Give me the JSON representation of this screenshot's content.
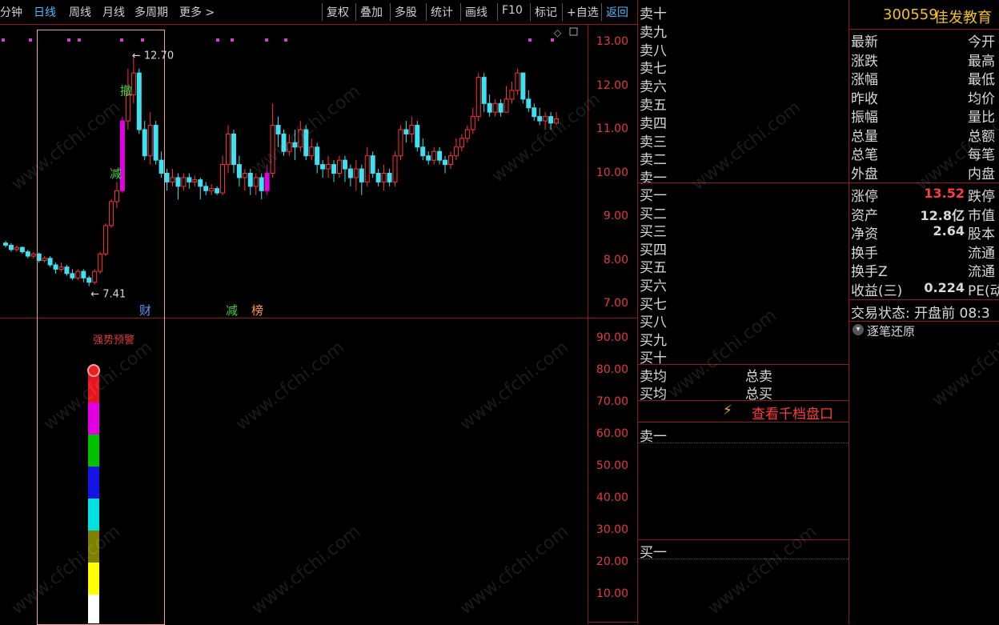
{
  "toolbar": {
    "left_items": [
      "分钟",
      "日线",
      "周线",
      "月线",
      "多周期",
      "更多 >"
    ],
    "right_items": [
      "复权",
      "叠加",
      "多股",
      "统计",
      "画线",
      "F10",
      "标记",
      "+自选",
      "返回"
    ],
    "active": "日线"
  },
  "chart": {
    "price_axis": [
      "13.00",
      "12.00",
      "11.00",
      "10.00",
      "9.00",
      "8.00",
      "7.00"
    ],
    "high_label": "12.70",
    "low_label": "7.41",
    "mark_labels": [
      "撤",
      "减"
    ],
    "event_tags": [
      "财",
      "减",
      "榜"
    ],
    "indicator_axis": [
      "90.00",
      "80.00",
      "70.00",
      "60.00",
      "50.00",
      "40.00",
      "30.00",
      "20.00",
      "10.00"
    ],
    "indicator_title": "强势预警"
  },
  "orderbook": {
    "sell_levels": [
      "卖十",
      "卖九",
      "卖八",
      "卖七",
      "卖六",
      "卖五",
      "卖四",
      "卖三",
      "卖二",
      "卖一"
    ],
    "buy_levels": [
      "买一",
      "买二",
      "买三",
      "买四",
      "买五",
      "买六",
      "买七",
      "买八",
      "买九",
      "买十"
    ],
    "sell_avg": "卖均",
    "buy_avg": "买均",
    "total_sell": "总卖",
    "total_buy": "总买",
    "thousand_link": "查看千档盘口",
    "detail_sell": "卖一",
    "detail_buy": "买一"
  },
  "quote": {
    "code": "300559",
    "name": "佳发教育",
    "left_labels": [
      "最新",
      "涨跌",
      "涨幅",
      "昨收",
      "振幅",
      "总量",
      "总笔",
      "外盘"
    ],
    "right_labels": [
      "今开",
      "最高",
      "最低",
      "均价",
      "量比",
      "总额",
      "每笔",
      "内盘"
    ],
    "stats": [
      {
        "label": "涨停",
        "value": "13.52",
        "right": "跌停"
      },
      {
        "label": "资产",
        "value": "12.8亿",
        "right": "市值"
      },
      {
        "label": "净资",
        "value": "2.64",
        "right": "股本"
      },
      {
        "label": "换手",
        "value": "",
        "right": "流通"
      },
      {
        "label": "换手Z",
        "value": "",
        "right": "流通"
      },
      {
        "label": "收益(三)",
        "value": "0.224",
        "right": "PE(动"
      }
    ],
    "trade_status": "交易状态: 开盘前 08:3",
    "tick_restore": "逐笔还原"
  },
  "watermark_text": "www.cfchi.com",
  "chart_data": {
    "type": "candlestick",
    "price_range": [
      6.8,
      13.4
    ],
    "up_color": "#ff3232",
    "down_color": "#40e0f0",
    "indicator_range": [
      5,
      97
    ],
    "indicator_blocks": [
      {
        "from": 80,
        "to": 70,
        "color": "#e6141e"
      },
      {
        "from": 70,
        "to": 60,
        "color": "#e000e0"
      },
      {
        "from": 60,
        "to": 50,
        "color": "#00c000"
      },
      {
        "from": 50,
        "to": 40,
        "color": "#1414e6"
      },
      {
        "from": 40,
        "to": 30,
        "color": "#00e0e0"
      },
      {
        "from": 30,
        "to": 20,
        "color": "#808000"
      },
      {
        "from": 20,
        "to": 10,
        "color": "#ffff00"
      },
      {
        "from": 10,
        "to": 1,
        "color": "#ffffff"
      }
    ],
    "candles": [
      {
        "o": 8.4,
        "c": 8.35,
        "h": 8.45,
        "l": 8.3
      },
      {
        "o": 8.35,
        "c": 8.25,
        "h": 8.4,
        "l": 8.2
      },
      {
        "o": 8.25,
        "c": 8.3,
        "h": 8.35,
        "l": 8.2
      },
      {
        "o": 8.3,
        "c": 8.2,
        "h": 8.32,
        "l": 8.15
      },
      {
        "o": 8.2,
        "c": 8.1,
        "h": 8.25,
        "l": 8.05
      },
      {
        "o": 8.1,
        "c": 8.15,
        "h": 8.2,
        "l": 8.05
      },
      {
        "o": 8.15,
        "c": 8.0,
        "h": 8.18,
        "l": 7.95
      },
      {
        "o": 8.0,
        "c": 8.05,
        "h": 8.1,
        "l": 7.95
      },
      {
        "o": 8.05,
        "c": 7.9,
        "h": 8.1,
        "l": 7.85
      },
      {
        "o": 7.9,
        "c": 7.8,
        "h": 7.95,
        "l": 7.7
      },
      {
        "o": 7.8,
        "c": 7.85,
        "h": 7.95,
        "l": 7.75
      },
      {
        "o": 7.85,
        "c": 7.7,
        "h": 7.9,
        "l": 7.65
      },
      {
        "o": 7.7,
        "c": 7.6,
        "h": 7.8,
        "l": 7.55
      },
      {
        "o": 7.6,
        "c": 7.75,
        "h": 7.8,
        "l": 7.55
      },
      {
        "o": 7.75,
        "c": 7.6,
        "h": 7.8,
        "l": 7.5
      },
      {
        "o": 7.6,
        "c": 7.5,
        "h": 7.65,
        "l": 7.41
      },
      {
        "o": 7.5,
        "c": 7.75,
        "h": 7.8,
        "l": 7.45
      },
      {
        "o": 7.75,
        "c": 8.15,
        "h": 8.2,
        "l": 7.7
      },
      {
        "o": 8.15,
        "c": 8.8,
        "h": 8.85,
        "l": 8.1
      },
      {
        "o": 8.8,
        "c": 9.35,
        "h": 9.4,
        "l": 8.75
      },
      {
        "o": 9.35,
        "c": 9.6,
        "h": 9.8,
        "l": 9.2
      },
      {
        "o": 9.6,
        "c": 11.2,
        "h": 11.3,
        "l": 9.55
      },
      {
        "o": 11.2,
        "c": 11.8,
        "h": 12.4,
        "l": 11.0
      },
      {
        "o": 11.8,
        "c": 12.3,
        "h": 12.7,
        "l": 11.6
      },
      {
        "o": 12.3,
        "c": 11.0,
        "h": 12.4,
        "l": 10.9
      },
      {
        "o": 11.0,
        "c": 10.4,
        "h": 11.2,
        "l": 10.3
      },
      {
        "o": 10.4,
        "c": 11.1,
        "h": 11.4,
        "l": 10.2
      },
      {
        "o": 11.1,
        "c": 10.3,
        "h": 11.2,
        "l": 10.2
      },
      {
        "o": 10.3,
        "c": 10.0,
        "h": 10.5,
        "l": 9.9
      },
      {
        "o": 10.0,
        "c": 9.8,
        "h": 10.1,
        "l": 9.6
      },
      {
        "o": 9.8,
        "c": 9.9,
        "h": 10.1,
        "l": 9.7
      },
      {
        "o": 9.9,
        "c": 9.7,
        "h": 10.0,
        "l": 9.4
      },
      {
        "o": 9.7,
        "c": 9.9,
        "h": 10.0,
        "l": 9.6
      },
      {
        "o": 9.9,
        "c": 9.8,
        "h": 10.0,
        "l": 9.65
      },
      {
        "o": 9.8,
        "c": 9.85,
        "h": 9.95,
        "l": 9.7
      },
      {
        "o": 9.85,
        "c": 9.7,
        "h": 9.9,
        "l": 9.4
      },
      {
        "o": 9.7,
        "c": 9.6,
        "h": 9.8,
        "l": 9.5
      },
      {
        "o": 9.6,
        "c": 9.65,
        "h": 9.75,
        "l": 9.5
      },
      {
        "o": 9.65,
        "c": 9.55,
        "h": 9.7,
        "l": 9.5
      },
      {
        "o": 9.55,
        "c": 10.2,
        "h": 10.4,
        "l": 9.5
      },
      {
        "o": 10.2,
        "c": 10.9,
        "h": 11.1,
        "l": 10.0
      },
      {
        "o": 10.9,
        "c": 10.2,
        "h": 11.0,
        "l": 10.0
      },
      {
        "o": 10.2,
        "c": 9.9,
        "h": 10.4,
        "l": 9.7
      },
      {
        "o": 9.9,
        "c": 10.0,
        "h": 10.1,
        "l": 9.6
      },
      {
        "o": 10.0,
        "c": 9.7,
        "h": 10.1,
        "l": 9.5
      },
      {
        "o": 9.7,
        "c": 9.9,
        "h": 10.0,
        "l": 9.5
      },
      {
        "o": 9.9,
        "c": 9.6,
        "h": 10.0,
        "l": 9.4
      },
      {
        "o": 9.6,
        "c": 10.0,
        "h": 10.2,
        "l": 9.5
      },
      {
        "o": 10.0,
        "c": 11.1,
        "h": 11.6,
        "l": 9.9
      },
      {
        "o": 11.1,
        "c": 10.9,
        "h": 11.3,
        "l": 10.6
      },
      {
        "o": 10.9,
        "c": 10.5,
        "h": 11.0,
        "l": 10.4
      },
      {
        "o": 10.5,
        "c": 10.7,
        "h": 10.9,
        "l": 10.4
      },
      {
        "o": 10.7,
        "c": 10.6,
        "h": 11.0,
        "l": 10.3
      },
      {
        "o": 10.6,
        "c": 11.0,
        "h": 11.2,
        "l": 10.5
      },
      {
        "o": 11.0,
        "c": 10.4,
        "h": 11.1,
        "l": 10.3
      },
      {
        "o": 10.4,
        "c": 10.6,
        "h": 10.8,
        "l": 10.3
      },
      {
        "o": 10.6,
        "c": 10.2,
        "h": 10.7,
        "l": 10.0
      },
      {
        "o": 10.2,
        "c": 10.1,
        "h": 10.3,
        "l": 9.9
      },
      {
        "o": 10.1,
        "c": 10.2,
        "h": 10.4,
        "l": 9.9
      },
      {
        "o": 10.2,
        "c": 10.0,
        "h": 10.3,
        "l": 9.8
      },
      {
        "o": 10.0,
        "c": 10.3,
        "h": 10.4,
        "l": 9.9
      },
      {
        "o": 10.3,
        "c": 10.1,
        "h": 10.4,
        "l": 9.8
      },
      {
        "o": 10.1,
        "c": 9.9,
        "h": 10.2,
        "l": 9.7
      },
      {
        "o": 9.9,
        "c": 10.1,
        "h": 10.3,
        "l": 9.6
      },
      {
        "o": 10.1,
        "c": 9.8,
        "h": 10.2,
        "l": 9.5
      },
      {
        "o": 9.8,
        "c": 10.4,
        "h": 10.6,
        "l": 9.7
      },
      {
        "o": 10.4,
        "c": 10.0,
        "h": 10.5,
        "l": 9.9
      },
      {
        "o": 10.0,
        "c": 9.8,
        "h": 10.1,
        "l": 9.7
      },
      {
        "o": 9.8,
        "c": 10.0,
        "h": 10.2,
        "l": 9.6
      },
      {
        "o": 10.0,
        "c": 9.8,
        "h": 10.1,
        "l": 9.7
      },
      {
        "o": 9.8,
        "c": 10.4,
        "h": 10.5,
        "l": 9.7
      },
      {
        "o": 10.4,
        "c": 11.0,
        "h": 11.1,
        "l": 10.3
      },
      {
        "o": 11.0,
        "c": 10.9,
        "h": 11.2,
        "l": 10.7
      },
      {
        "o": 10.9,
        "c": 11.1,
        "h": 11.3,
        "l": 10.7
      },
      {
        "o": 11.1,
        "c": 10.6,
        "h": 11.2,
        "l": 10.5
      },
      {
        "o": 10.6,
        "c": 10.4,
        "h": 10.8,
        "l": 10.3
      },
      {
        "o": 10.4,
        "c": 10.3,
        "h": 10.5,
        "l": 10.2
      },
      {
        "o": 10.3,
        "c": 10.5,
        "h": 10.6,
        "l": 10.2
      },
      {
        "o": 10.5,
        "c": 10.3,
        "h": 10.6,
        "l": 10.2
      },
      {
        "o": 10.3,
        "c": 10.2,
        "h": 10.4,
        "l": 10.0
      },
      {
        "o": 10.2,
        "c": 10.4,
        "h": 10.5,
        "l": 10.1
      },
      {
        "o": 10.4,
        "c": 10.6,
        "h": 10.8,
        "l": 10.3
      },
      {
        "o": 10.6,
        "c": 10.8,
        "h": 10.9,
        "l": 10.5
      },
      {
        "o": 10.8,
        "c": 11.0,
        "h": 11.1,
        "l": 10.7
      },
      {
        "o": 11.0,
        "c": 11.3,
        "h": 11.5,
        "l": 10.9
      },
      {
        "o": 11.3,
        "c": 12.2,
        "h": 12.3,
        "l": 11.2
      },
      {
        "o": 12.2,
        "c": 11.6,
        "h": 12.3,
        "l": 11.4
      },
      {
        "o": 11.6,
        "c": 11.4,
        "h": 11.8,
        "l": 11.3
      },
      {
        "o": 11.4,
        "c": 11.6,
        "h": 11.7,
        "l": 11.3
      },
      {
        "o": 11.6,
        "c": 11.4,
        "h": 11.7,
        "l": 11.3
      },
      {
        "o": 11.4,
        "c": 11.7,
        "h": 12.0,
        "l": 11.4
      },
      {
        "o": 11.7,
        "c": 11.9,
        "h": 12.1,
        "l": 11.6
      },
      {
        "o": 11.9,
        "c": 12.3,
        "h": 12.4,
        "l": 11.8
      },
      {
        "o": 12.3,
        "c": 11.7,
        "h": 12.3,
        "l": 11.6
      },
      {
        "o": 11.7,
        "c": 11.5,
        "h": 11.9,
        "l": 11.4
      },
      {
        "o": 11.5,
        "c": 11.3,
        "h": 11.6,
        "l": 11.2
      },
      {
        "o": 11.3,
        "c": 11.2,
        "h": 11.5,
        "l": 11.1
      },
      {
        "o": 11.2,
        "c": 11.3,
        "h": 11.4,
        "l": 11.0
      },
      {
        "o": 11.3,
        "c": 11.15,
        "h": 11.4,
        "l": 11.0
      },
      {
        "o": 11.15,
        "c": 11.25,
        "h": 11.4,
        "l": 11.1
      }
    ]
  }
}
